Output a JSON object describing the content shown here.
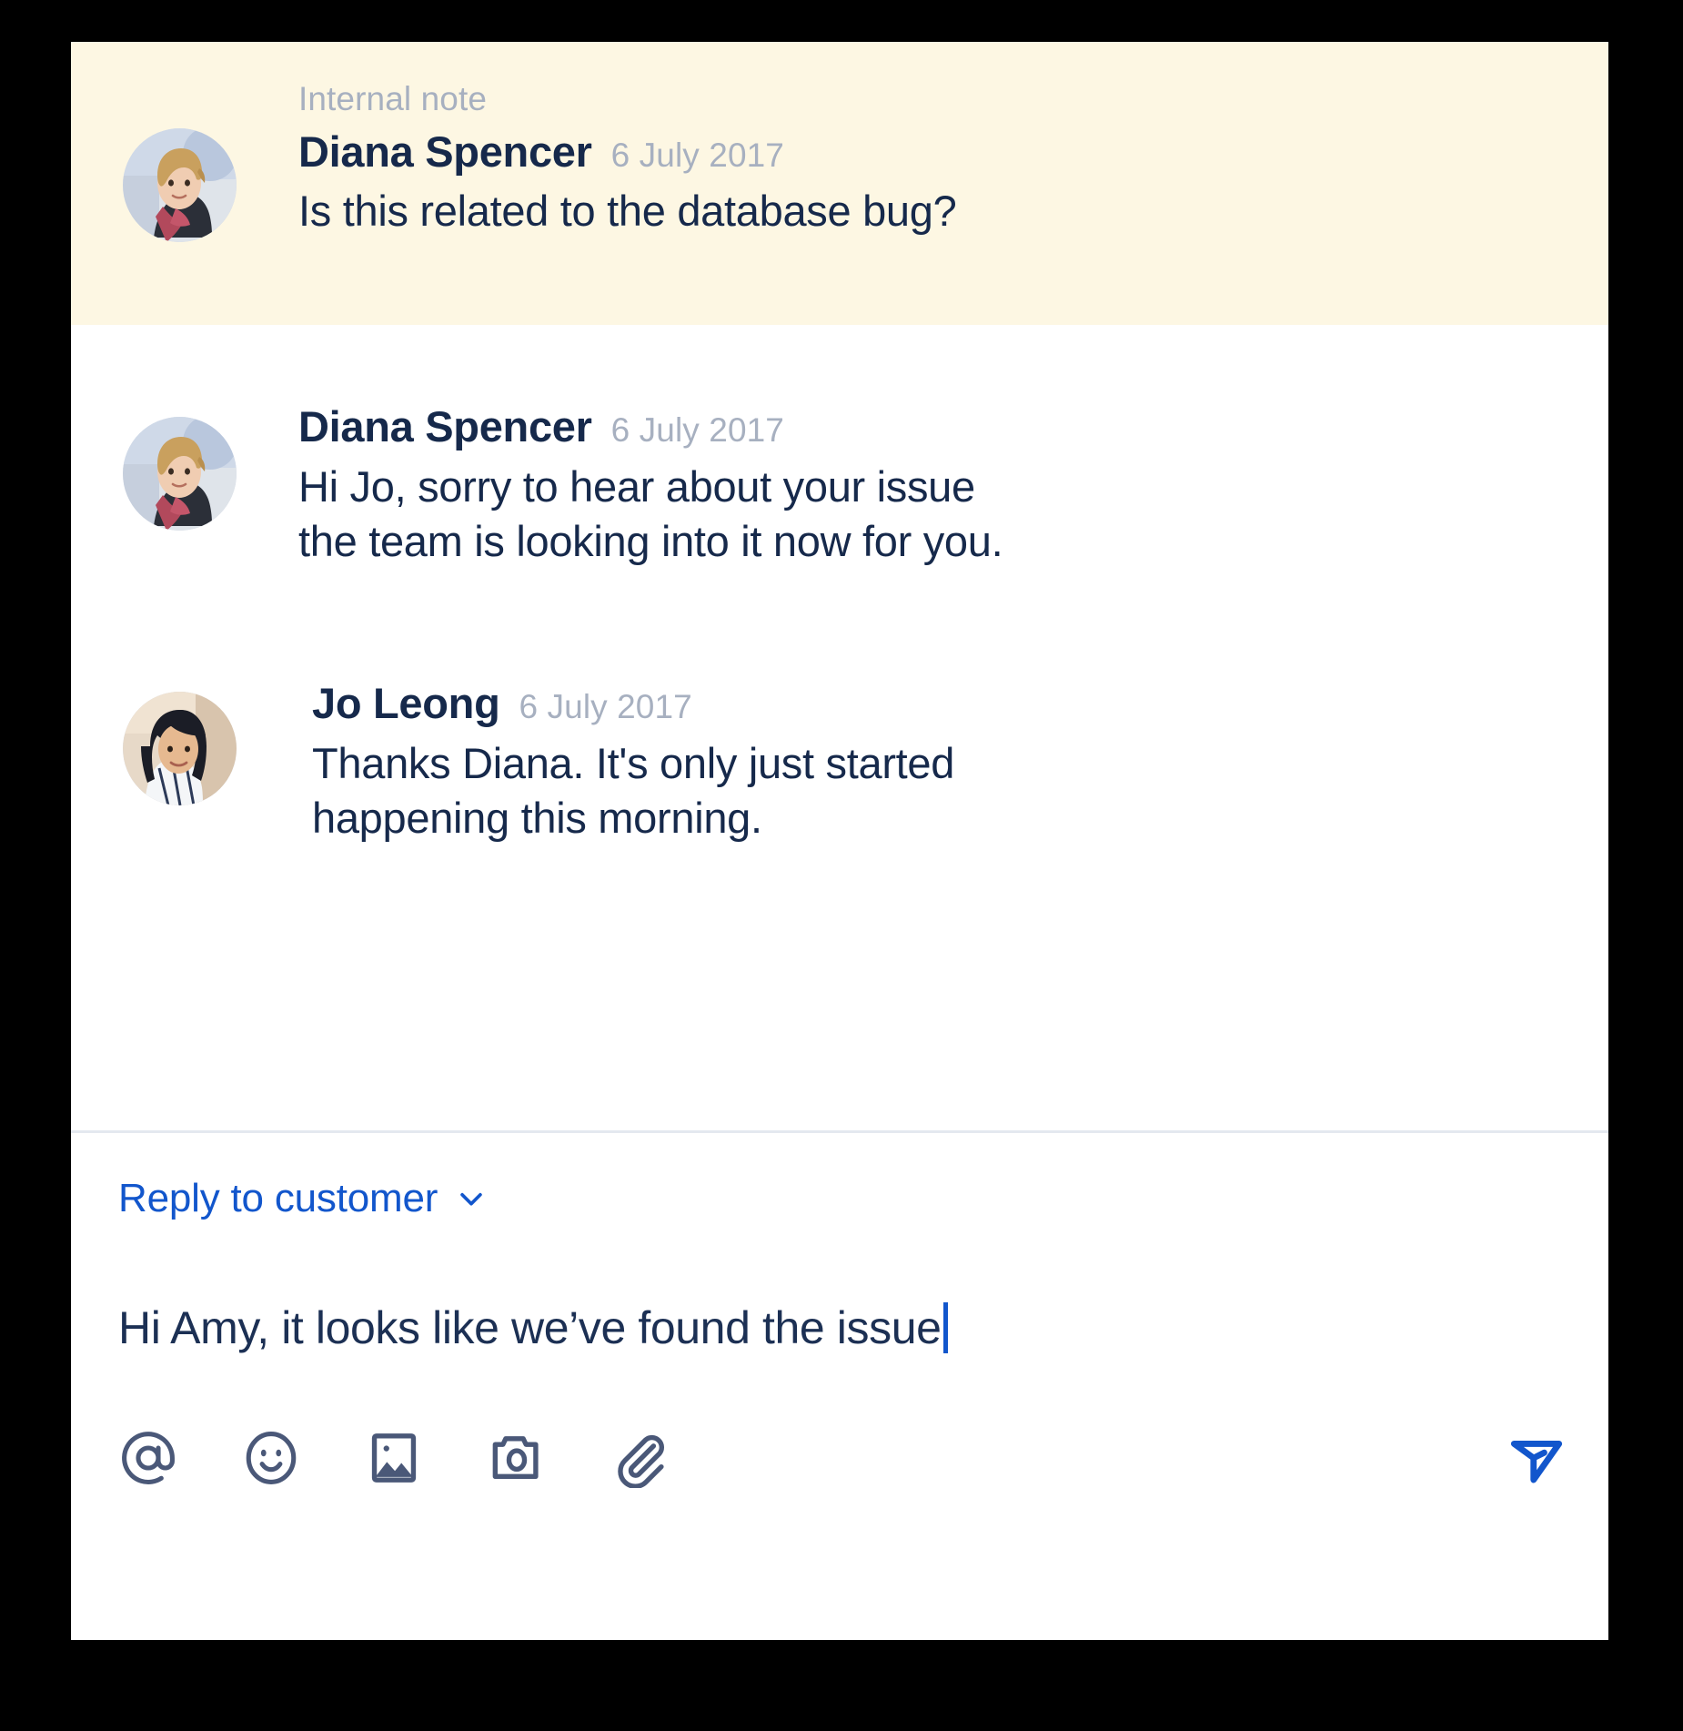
{
  "conversation": {
    "internal_note": {
      "kicker": "Internal note",
      "author": "Diana Spencer",
      "timestamp": "6 July 2017",
      "text": "Is this related to the database bug?",
      "background_color": "#fdf7e3",
      "avatar_name": "diana-spencer-avatar"
    },
    "messages": [
      {
        "author": "Diana Spencer",
        "timestamp": "6 July 2017",
        "line1": "Hi Jo, sorry to hear about your issue",
        "line2": "the team is looking into it now for you.",
        "avatar_name": "diana-spencer-avatar"
      },
      {
        "author": "Jo Leong",
        "timestamp": "6 July 2017",
        "line1": "Thanks Diana. It's only just started",
        "line2": "happening this morning.",
        "avatar_name": "jo-leong-avatar"
      }
    ]
  },
  "composer": {
    "reply_mode_label": "Reply to customer",
    "reply_mode_chevron": "chevron-down-icon",
    "draft_text": "Hi Amy, it looks like we’ve found the issue",
    "toolbar": [
      {
        "name": "mention-icon",
        "label": "@"
      },
      {
        "name": "emoji-icon",
        "label": "Emoji"
      },
      {
        "name": "image-icon",
        "label": "Image"
      },
      {
        "name": "camera-icon",
        "label": "Camera"
      },
      {
        "name": "attachment-icon",
        "label": "Attachment"
      }
    ],
    "send": {
      "name": "send-icon",
      "label": "Send"
    }
  },
  "colors": {
    "note_background": "#fdf7e3",
    "panel_background": "#ffffff",
    "text_primary": "#16294b",
    "text_muted": "#a7b0c0",
    "accent_blue": "#1256cc",
    "icon_slate": "#4a5878",
    "divider": "#e4e8ef",
    "page_background": "#000000"
  }
}
